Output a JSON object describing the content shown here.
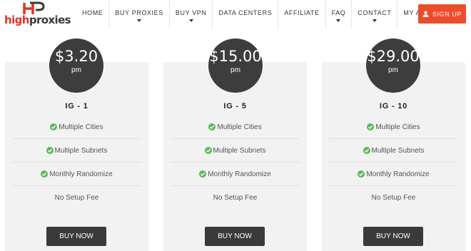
{
  "brand": {
    "logo_text_1": "high",
    "logo_text_2": "proxies"
  },
  "nav": {
    "items": [
      {
        "label": "HOME",
        "dropdown": false
      },
      {
        "label": "BUY PROXIES",
        "dropdown": true
      },
      {
        "label": "BUY VPN",
        "dropdown": true
      },
      {
        "label": "DATA CENTERS",
        "dropdown": false
      },
      {
        "label": "AFFILIATE",
        "dropdown": false
      },
      {
        "label": "FAQ",
        "dropdown": true
      },
      {
        "label": "CONTACT",
        "dropdown": true
      },
      {
        "label": "MY ACCOUNT",
        "dropdown": true
      }
    ],
    "signup_label": "SIGN UP"
  },
  "plans": [
    {
      "price": "$3.20",
      "unit": "pm",
      "name": "IG - 1",
      "features": [
        "Multiple Cities",
        "Multiple Subnets",
        "Monthly Randomize",
        "No Setup Fee"
      ],
      "button": "BUY NOW"
    },
    {
      "price": "$15.00",
      "unit": "pm",
      "name": "IG - 5",
      "features": [
        "Multiple Cities",
        "Multiple Subnets",
        "Monthly Randomize",
        "No Setup Fee"
      ],
      "button": "BUY NOW"
    },
    {
      "price": "$29.00",
      "unit": "pm",
      "name": "IG - 10",
      "features": [
        "Multiple Cities",
        "Multiple Subnets",
        "Monthly Randomize",
        "No Setup Fee"
      ],
      "button": "BUY NOW"
    }
  ],
  "colors": {
    "accent": "#ee4b2b",
    "dark": "#3d3d3d",
    "check": "#5cb85c",
    "card": "#f2f2f2"
  }
}
